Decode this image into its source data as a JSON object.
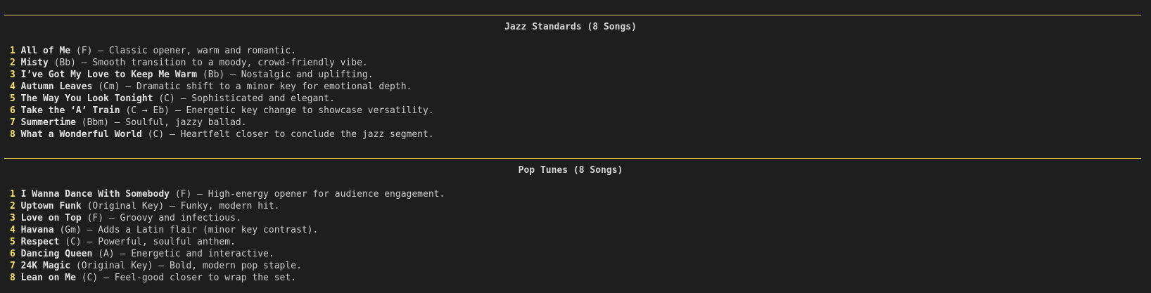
{
  "sections": [
    {
      "heading": "Jazz Standards (8 Songs)",
      "songs": [
        {
          "num": "1",
          "title": "All of Me",
          "rest": " (F) – Classic opener, warm and romantic."
        },
        {
          "num": "2",
          "title": "Misty",
          "rest": " (Bb) – Smooth transition to a moody, crowd-friendly vibe."
        },
        {
          "num": "3",
          "title": "I’ve Got My Love to Keep Me Warm",
          "rest": " (Bb) – Nostalgic and uplifting."
        },
        {
          "num": "4",
          "title": "Autumn Leaves",
          "rest": " (Cm) – Dramatic shift to a minor key for emotional depth."
        },
        {
          "num": "5",
          "title": "The Way You Look Tonight",
          "rest": " (C) – Sophisticated and elegant."
        },
        {
          "num": "6",
          "title": "Take the ‘A’ Train",
          "rest": " (C → Eb) – Energetic key change to showcase versatility."
        },
        {
          "num": "7",
          "title": "Summertime",
          "rest": " (Bbm) – Soulful, jazzy ballad."
        },
        {
          "num": "8",
          "title": "What a Wonderful World",
          "rest": " (C) – Heartfelt closer to conclude the jazz segment."
        }
      ]
    },
    {
      "heading": "Pop Tunes (8 Songs)",
      "songs": [
        {
          "num": "1",
          "title": "I Wanna Dance With Somebody",
          "rest": " (F) – High-energy opener for audience engagement."
        },
        {
          "num": "2",
          "title": "Uptown Funk",
          "rest": " (Original Key) – Funky, modern hit."
        },
        {
          "num": "3",
          "title": "Love on Top",
          "rest": " (F) – Groovy and infectious."
        },
        {
          "num": "4",
          "title": "Havana",
          "rest": " (Gm) – Adds a Latin flair (minor key contrast)."
        },
        {
          "num": "5",
          "title": "Respect",
          "rest": " (C) – Powerful, soulful anthem."
        },
        {
          "num": "6",
          "title": "Dancing Queen",
          "rest": " (A) – Energetic and interactive."
        },
        {
          "num": "7",
          "title": "24K Magic",
          "rest": " (Original Key) – Bold, modern pop staple."
        },
        {
          "num": "8",
          "title": "Lean on Me",
          "rest": " (C) – Feel-good closer to wrap the set."
        }
      ]
    }
  ],
  "colors": {
    "background": "#1e1e1e",
    "rule": "#d7c64a",
    "number": "#ffe26a"
  }
}
